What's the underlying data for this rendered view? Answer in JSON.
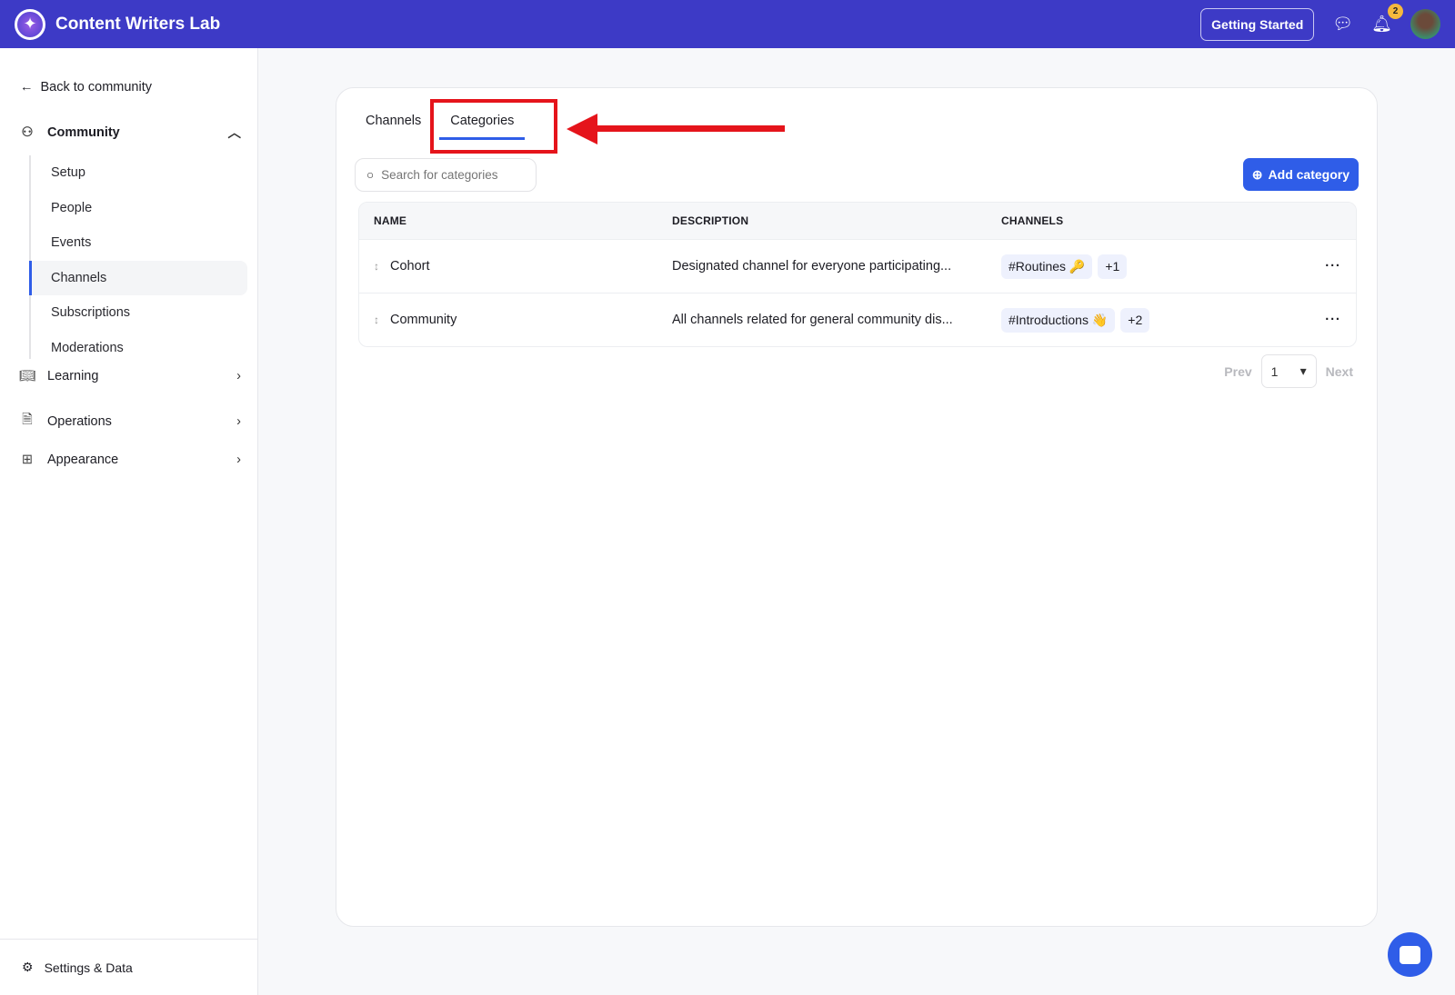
{
  "header": {
    "brand": "Content Writers Lab",
    "getting_started": "Getting Started",
    "notification_count": "2"
  },
  "sidebar": {
    "back": "Back to community",
    "community": "Community",
    "sub_items": [
      "Setup",
      "People",
      "Events",
      "Channels",
      "Subscriptions",
      "Moderations"
    ],
    "active": "Channels",
    "learning": "Learning",
    "operations": "Operations",
    "appearance": "Appearance",
    "settings": "Settings & Data"
  },
  "main": {
    "tabs": [
      "Channels",
      "Categories"
    ],
    "active_tab": "Categories",
    "search_placeholder": "Search for categories",
    "add_button": "Add category",
    "columns": [
      "NAME",
      "DESCRIPTION",
      "CHANNELS"
    ],
    "rows": [
      {
        "name": "Cohort",
        "description": "Designated channel for everyone participating...",
        "channel": "#Routines 🔑",
        "more": "+1"
      },
      {
        "name": "Community",
        "description": "All channels related for general community dis...",
        "channel": "#Introductions 👋",
        "more": "+2"
      }
    ],
    "pager": {
      "prev": "Prev",
      "page": "1",
      "next": "Next"
    }
  },
  "colors": {
    "header": "#3d3ac6",
    "accent": "#2f5de8",
    "highlight": "#e5141b"
  }
}
